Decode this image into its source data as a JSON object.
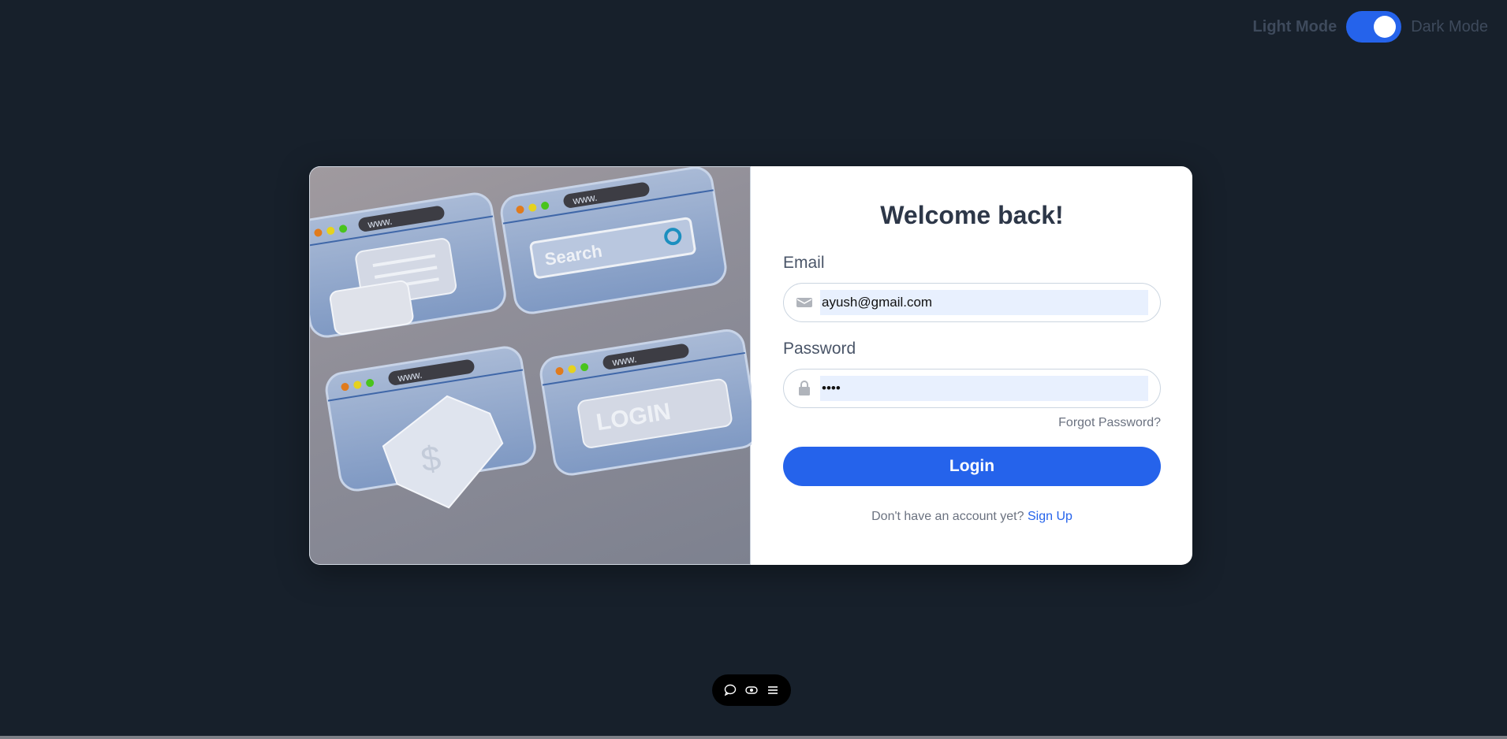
{
  "theme": {
    "light_label": "Light Mode",
    "dark_label": "Dark Mode",
    "dark_enabled": true
  },
  "illustration": {
    "labels": {
      "www": "www.",
      "search": "Search",
      "login": "LOGIN",
      "currency": "$"
    }
  },
  "form": {
    "title": "Welcome back!",
    "email": {
      "label": "Email",
      "value": "ayush@gmail.com",
      "icon": "envelope-icon"
    },
    "password": {
      "label": "Password",
      "value": "••••",
      "icon": "lock-icon"
    },
    "forgot_label": "Forgot Password?",
    "login_label": "Login",
    "signup_prompt": "Don't have an account yet?",
    "signup_link": "Sign Up"
  },
  "toolbar": {
    "icons": [
      "chat-icon",
      "toggle-icon",
      "menu-icon"
    ]
  },
  "colors": {
    "accent": "#2563eb",
    "background": "#17202b",
    "card": "#ffffff"
  }
}
